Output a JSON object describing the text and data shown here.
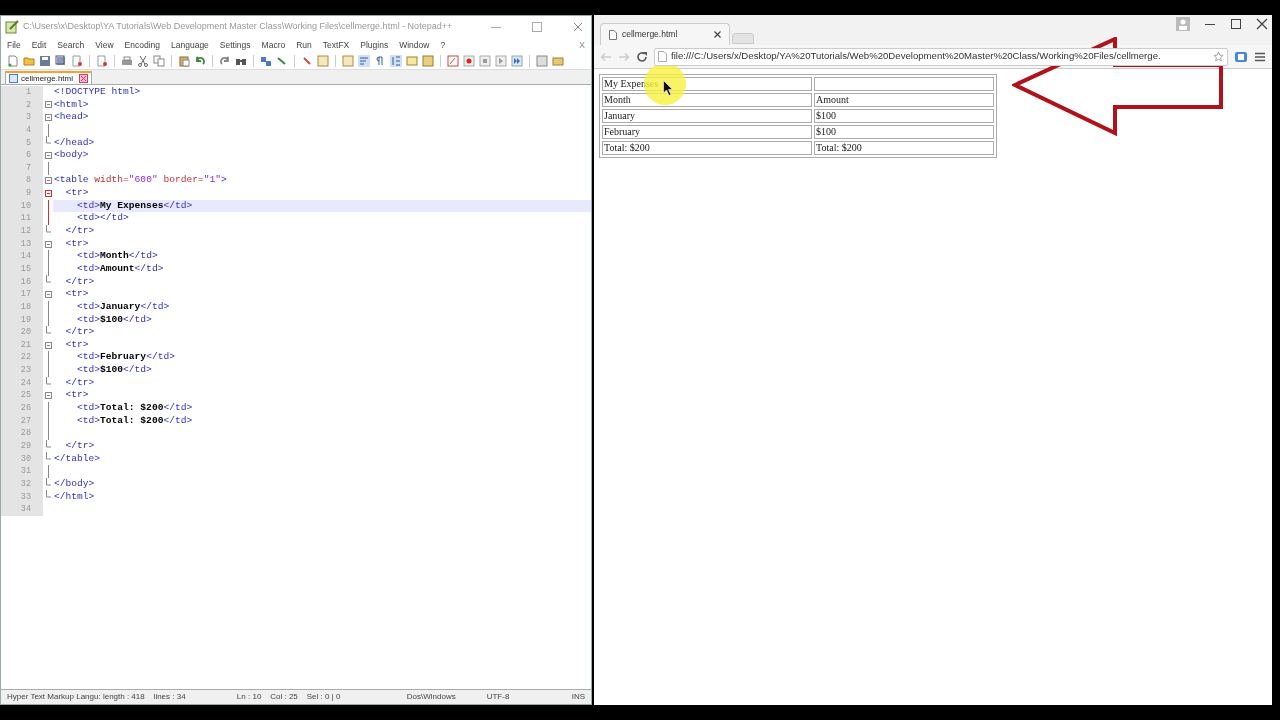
{
  "editor": {
    "title": "C:\\Users\\x\\Desktop\\YA Tutorials\\Web Development Master Class\\Working Files\\cellmerge.html - Notepad++",
    "menu": [
      "File",
      "Edit",
      "Search",
      "View",
      "Encoding",
      "Language",
      "Settings",
      "Macro",
      "Run",
      "TextFX",
      "Plugins",
      "Window",
      "?"
    ],
    "close_doc": "X",
    "tabs": [
      {
        "label": "cellmerge.html",
        "selected": true
      }
    ],
    "lines": [
      {
        "number": "1",
        "kind": "none",
        "active": false,
        "selected": false,
        "segments": [
          {
            "kind": "tag",
            "text": "<!DOCTYPE html>"
          }
        ]
      },
      {
        "number": "2",
        "kind": "start",
        "active": false,
        "selected": false,
        "segments": [
          {
            "kind": "tag",
            "text": "<html>"
          }
        ]
      },
      {
        "number": "3",
        "kind": "start",
        "active": false,
        "selected": false,
        "segments": [
          {
            "kind": "tag",
            "text": "<head>"
          }
        ]
      },
      {
        "number": "4",
        "kind": "inner",
        "active": false,
        "selected": false
      },
      {
        "number": "5",
        "kind": "end",
        "active": false,
        "selected": false,
        "segments": [
          {
            "kind": "tag",
            "text": "</head>"
          }
        ]
      },
      {
        "number": "6",
        "kind": "start",
        "active": false,
        "selected": false,
        "segments": [
          {
            "kind": "tag",
            "text": "<body>"
          }
        ]
      },
      {
        "number": "7",
        "kind": "inner",
        "active": false,
        "selected": false
      },
      {
        "number": "8",
        "kind": "start",
        "active": false,
        "selected": false,
        "segments": [
          {
            "kind": "tag",
            "text": "<table "
          },
          {
            "kind": "attr",
            "text": "width="
          },
          {
            "kind": "value",
            "text": "\"600\" "
          },
          {
            "kind": "attr",
            "text": "border="
          },
          {
            "kind": "value",
            "text": "\"1\""
          },
          {
            "kind": "tag",
            "text": ">"
          }
        ]
      },
      {
        "number": "9",
        "kind": "start",
        "active": true,
        "selected": false,
        "segments": [
          {
            "kind": "tag",
            "text": "  <tr>"
          }
        ]
      },
      {
        "number": "10",
        "kind": "inner",
        "active": true,
        "selected": true,
        "segments": [
          {
            "kind": "tag",
            "text": "    <td>"
          },
          {
            "kind": "text",
            "text": "My Expenses"
          },
          {
            "kind": "tag",
            "text": "</td>"
          }
        ]
      },
      {
        "number": "11",
        "kind": "inner",
        "active": true,
        "selected": false,
        "segments": [
          {
            "kind": "tag",
            "text": "    <td></td>"
          }
        ]
      },
      {
        "number": "12",
        "kind": "end",
        "active": false,
        "selected": false,
        "segments": [
          {
            "kind": "tag",
            "text": "  </tr>"
          }
        ]
      },
      {
        "number": "13",
        "kind": "start",
        "active": false,
        "selected": false,
        "segments": [
          {
            "kind": "tag",
            "text": "  <tr>"
          }
        ]
      },
      {
        "number": "14",
        "kind": "inner",
        "active": false,
        "selected": false,
        "segments": [
          {
            "kind": "tag",
            "text": "    <td>"
          },
          {
            "kind": "text",
            "text": "Month"
          },
          {
            "kind": "tag",
            "text": "</td>"
          }
        ]
      },
      {
        "number": "15",
        "kind": "inner",
        "active": false,
        "selected": false,
        "segments": [
          {
            "kind": "tag",
            "text": "    <td>"
          },
          {
            "kind": "text",
            "text": "Amount"
          },
          {
            "kind": "tag",
            "text": "</td>"
          }
        ]
      },
      {
        "number": "16",
        "kind": "end",
        "active": false,
        "selected": false,
        "segments": [
          {
            "kind": "tag",
            "text": "  </tr>"
          }
        ]
      },
      {
        "number": "17",
        "kind": "start",
        "active": false,
        "selected": false,
        "segments": [
          {
            "kind": "tag",
            "text": "  <tr>"
          }
        ]
      },
      {
        "number": "18",
        "kind": "inner",
        "active": false,
        "selected": false,
        "segments": [
          {
            "kind": "tag",
            "text": "    <td>"
          },
          {
            "kind": "text",
            "text": "January"
          },
          {
            "kind": "tag",
            "text": "</td>"
          }
        ]
      },
      {
        "number": "19",
        "kind": "inner",
        "active": false,
        "selected": false,
        "segments": [
          {
            "kind": "tag",
            "text": "    <td>"
          },
          {
            "kind": "text",
            "text": "$100"
          },
          {
            "kind": "tag",
            "text": "</td>"
          }
        ]
      },
      {
        "number": "20",
        "kind": "end",
        "active": false,
        "selected": false,
        "segments": [
          {
            "kind": "tag",
            "text": "  </tr>"
          }
        ]
      },
      {
        "number": "21",
        "kind": "start",
        "active": false,
        "selected": false,
        "segments": [
          {
            "kind": "tag",
            "text": "  <tr>"
          }
        ]
      },
      {
        "number": "22",
        "kind": "inner",
        "active": false,
        "selected": false,
        "segments": [
          {
            "kind": "tag",
            "text": "    <td>"
          },
          {
            "kind": "text",
            "text": "February"
          },
          {
            "kind": "tag",
            "text": "</td>"
          }
        ]
      },
      {
        "number": "23",
        "kind": "inner",
        "active": false,
        "selected": false,
        "segments": [
          {
            "kind": "tag",
            "text": "    <td>"
          },
          {
            "kind": "text",
            "text": "$100"
          },
          {
            "kind": "tag",
            "text": "</td>"
          }
        ]
      },
      {
        "number": "24",
        "kind": "end",
        "active": false,
        "selected": false,
        "segments": [
          {
            "kind": "tag",
            "text": "  </tr>"
          }
        ]
      },
      {
        "number": "25",
        "kind": "start",
        "active": false,
        "selected": false,
        "segments": [
          {
            "kind": "tag",
            "text": "  <tr>"
          }
        ]
      },
      {
        "number": "26",
        "kind": "inner",
        "active": false,
        "selected": false,
        "segments": [
          {
            "kind": "tag",
            "text": "    <td>"
          },
          {
            "kind": "text",
            "text": "Total: $200"
          },
          {
            "kind": "tag",
            "text": "</td>"
          }
        ]
      },
      {
        "number": "27",
        "kind": "inner",
        "active": false,
        "selected": false,
        "segments": [
          {
            "kind": "tag",
            "text": "    <td>"
          },
          {
            "kind": "text",
            "text": "Total: $200"
          },
          {
            "kind": "tag",
            "text": "</td>"
          }
        ]
      },
      {
        "number": "28",
        "kind": "inner",
        "active": false,
        "selected": false
      },
      {
        "number": "29",
        "kind": "end",
        "active": false,
        "selected": false,
        "segments": [
          {
            "kind": "tag",
            "text": "  </tr>"
          }
        ]
      },
      {
        "number": "30",
        "kind": "end",
        "active": false,
        "selected": false,
        "segments": [
          {
            "kind": "tag",
            "text": "</table>"
          }
        ]
      },
      {
        "number": "31",
        "kind": "inner",
        "active": false,
        "selected": false
      },
      {
        "number": "32",
        "kind": "end",
        "active": false,
        "selected": false,
        "segments": [
          {
            "kind": "tag",
            "text": "</body>"
          }
        ]
      },
      {
        "number": "33",
        "kind": "end",
        "active": false,
        "selected": false,
        "segments": [
          {
            "kind": "tag",
            "text": "</html>"
          }
        ]
      },
      {
        "number": "34",
        "kind": "none",
        "active": false,
        "selected": false
      }
    ],
    "status_bar": [
      "Hyper Text Markup Langu: length : 418    lines : 34",
      "Ln : 10    Col : 25    Sel : 0 | 0",
      "Dos\\Windows",
      "UTF-8",
      "INS"
    ]
  },
  "browser": {
    "tabs": [
      {
        "label": "cellmerge.html",
        "selected": true
      }
    ],
    "address": "file:///C:/Users/x/Desktop/YA%20Tutorials/Web%20Development%20Master%20Class/Working%20Files/cellmerge.",
    "table": [
      [
        "My Expenses"
      ],
      [
        "Month",
        "Amount"
      ],
      [
        "January",
        "$100"
      ],
      [
        "February",
        "$100"
      ],
      [
        "Total: $200",
        "Total: $200"
      ]
    ]
  }
}
